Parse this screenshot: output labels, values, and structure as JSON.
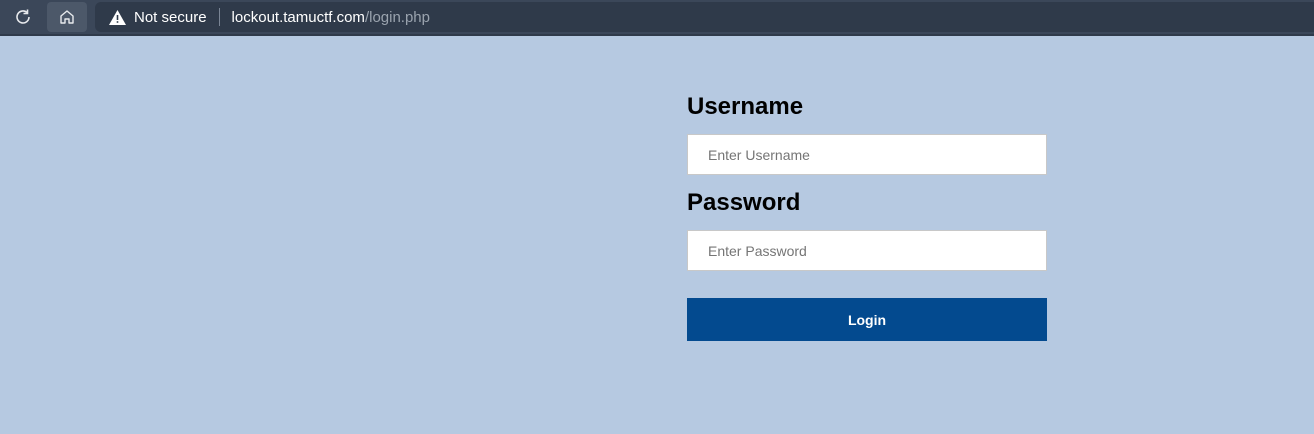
{
  "browser": {
    "security_label": "Not secure",
    "url_host": "lockout.tamuctf.com",
    "url_path": "/login.php",
    "icons": [
      "reload-icon",
      "home-icon",
      "warning-icon"
    ]
  },
  "form": {
    "username_label": "Username",
    "username_placeholder": "Enter Username",
    "username_value": "",
    "password_label": "Password",
    "password_placeholder": "Enter Password",
    "password_value": "",
    "login_label": "Login"
  },
  "colors": {
    "background": "#b6c9e1",
    "button": "#034a8f",
    "toolbar": "#3b4759"
  }
}
